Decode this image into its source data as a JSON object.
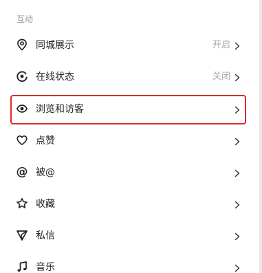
{
  "section": {
    "title": "互动"
  },
  "rows": [
    {
      "label": "同城展示",
      "value": "开启",
      "icon": "location-pin-icon"
    },
    {
      "label": "在线状态",
      "value": "关闭",
      "icon": "online-status-icon"
    },
    {
      "label": "浏览和访客",
      "value": "",
      "icon": "eye-icon"
    },
    {
      "label": "点赞",
      "value": "",
      "icon": "heart-icon"
    },
    {
      "label": "被@",
      "value": "",
      "icon": "at-sign-icon",
      "glyph": "@"
    },
    {
      "label": "收藏",
      "value": "",
      "icon": "star-icon"
    },
    {
      "label": "私信",
      "value": "",
      "icon": "send-icon"
    },
    {
      "label": "音乐",
      "value": "",
      "icon": "music-note-icon"
    }
  ],
  "colors": {
    "highlight_border": "#dd2a24",
    "label_text": "#222222",
    "value_text": "#a6a6a6",
    "section_text": "#9a9a9a"
  }
}
